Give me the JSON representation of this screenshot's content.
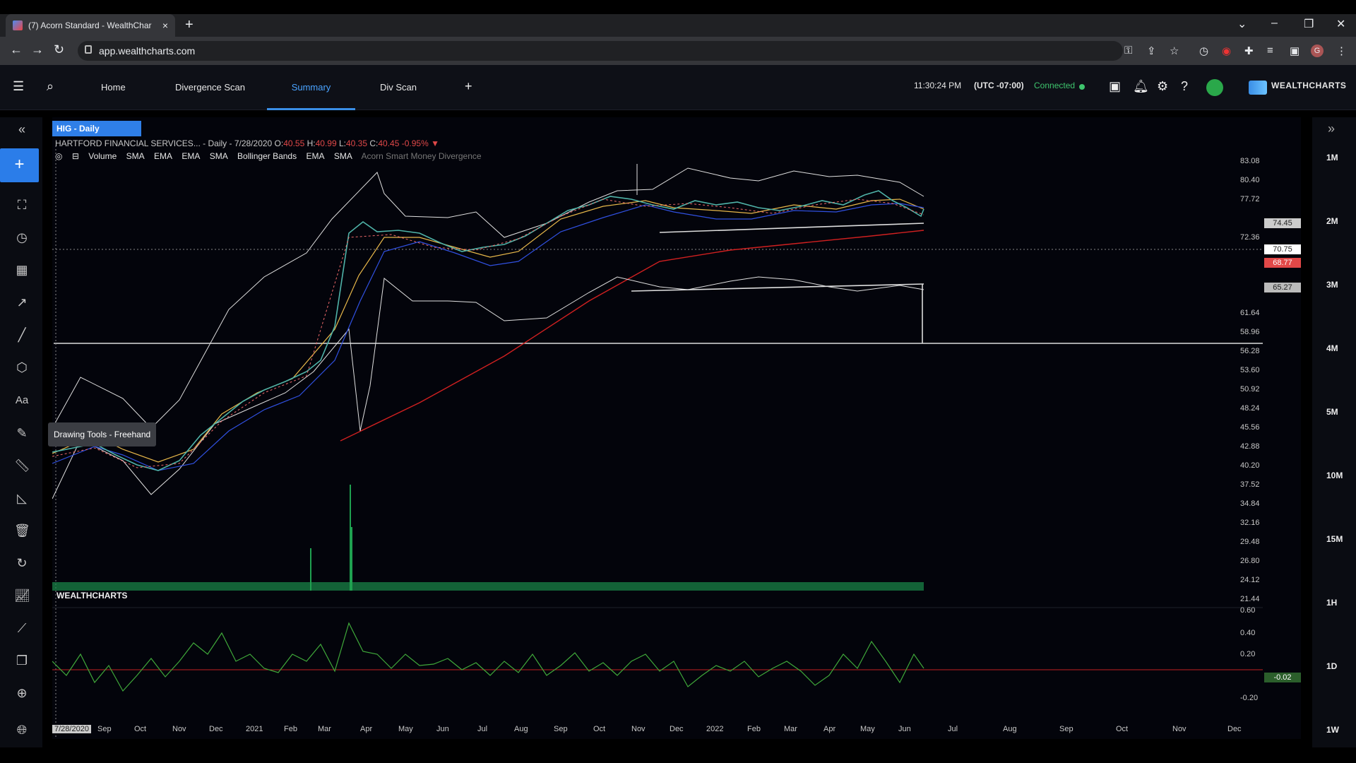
{
  "browser": {
    "tab_title": "(7) Acorn Standard - WealthChar",
    "url": "app.wealthcharts.com"
  },
  "header": {
    "nav": [
      "Home",
      "Divergence Scan",
      "Summary",
      "Div Scan"
    ],
    "active_tab": "Summary",
    "time": "11:30:24 PM",
    "timezone": "(UTC -07:00)",
    "connection": "Connected",
    "brand": "WEALTHCHARTS"
  },
  "chart_header": {
    "symbol_tag": "HIG - Daily",
    "name": "HARTFORD FINANCIAL SERVICES...",
    "info": "- Daily - 7/28/2020 O:",
    "open": "40.55",
    "high_lbl": "H:",
    "high": "40.99",
    "low_lbl": "L:",
    "low": "40.35",
    "close_lbl": "C:",
    "close": "40.45",
    "change": "-0.95%",
    "indicators": [
      "Volume",
      "SMA",
      "EMA",
      "EMA",
      "SMA",
      "Bollinger Bands",
      "EMA",
      "SMA"
    ],
    "indicator_dim": "Acorn Smart Money Divergence"
  },
  "tooltip": "Drawing Tools - Freehand",
  "watermark": "WEALTHCHARTS",
  "y_axis": [
    "83.08",
    "80.40",
    "77.72",
    "72.36",
    "61.64",
    "58.96",
    "56.28",
    "53.60",
    "50.92",
    "48.24",
    "45.56",
    "42.88",
    "40.20",
    "37.52",
    "34.84",
    "32.16",
    "29.48",
    "26.80",
    "24.12",
    "21.44"
  ],
  "price_boxes": [
    "74.45",
    "70.75",
    "68.77",
    "65.27"
  ],
  "osc_axis": [
    "0.60",
    "0.40",
    "0.20",
    "-0.20"
  ],
  "osc_value": "-0.02",
  "x_axis": [
    "Sep",
    "Oct",
    "Nov",
    "Dec",
    "2021",
    "Feb",
    "Mar",
    "Apr",
    "May",
    "Jun",
    "Jul",
    "Aug",
    "Sep",
    "Oct",
    "Nov",
    "Dec",
    "2022",
    "Feb",
    "Mar",
    "Apr",
    "May",
    "Jun",
    "Jul",
    "Aug",
    "Sep",
    "Oct",
    "Nov",
    "Dec"
  ],
  "x_cursor": "7/28/2020",
  "timeframes": [
    "1M",
    "2M",
    "3M",
    "4M",
    "5M",
    "10M",
    "15M",
    "1H",
    "1D",
    "1W"
  ],
  "colors": {
    "accent": "#2f7fe8",
    "bull": "#26a69a",
    "bear": "#ef5350",
    "sma200": "#d02020",
    "ema_fast": "#e8b84a",
    "ema_slow": "#3050e0"
  }
}
